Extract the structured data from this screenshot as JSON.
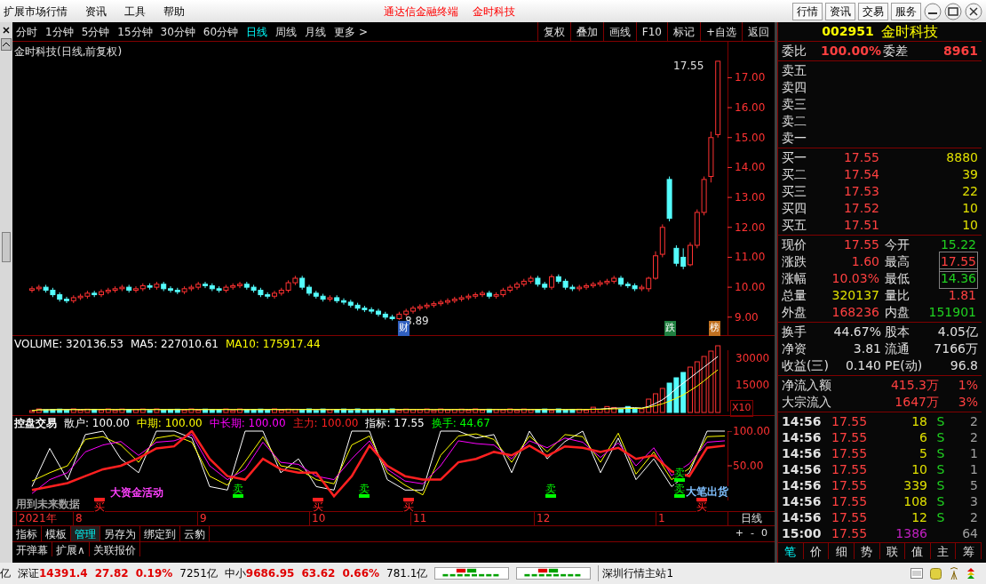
{
  "menu_bar": {
    "items": [
      "扩展市场行情",
      "资讯",
      "工具",
      "帮助"
    ],
    "title_parts": [
      "通达信金融终端",
      "金时科技"
    ],
    "buttons": [
      "行情",
      "资讯",
      "交易",
      "服务"
    ]
  },
  "period_tabs": [
    {
      "label": "分时",
      "selected": false
    },
    {
      "label": "1分钟",
      "selected": false
    },
    {
      "label": "5分钟",
      "selected": false
    },
    {
      "label": "15分钟",
      "selected": false
    },
    {
      "label": "30分钟",
      "selected": false
    },
    {
      "label": "60分钟",
      "selected": false
    },
    {
      "label": "日线",
      "selected": true
    },
    {
      "label": "周线",
      "selected": false
    },
    {
      "label": "月线",
      "selected": false
    },
    {
      "label": "更多 >",
      "selected": false
    }
  ],
  "toolbar_buttons": [
    "复权",
    "叠加",
    "画线",
    "F10",
    "标记",
    "+自选",
    "返回"
  ],
  "chart": {
    "title": "金时科技(日线,前复权)",
    "high_label": "17.55",
    "low_label": "8.89",
    "event_marks": [
      {
        "label": "财",
        "color": "#3060c0"
      },
      {
        "label": "跌",
        "color": "#208040"
      },
      {
        "label": "榜",
        "color": "#c07020"
      }
    ],
    "chart_data": {
      "type": "candlestick",
      "ylim": [
        8.4,
        18.2
      ],
      "yticks": [
        {
          "value": 17,
          "label": "17.00"
        },
        {
          "value": 16,
          "label": "16.00"
        },
        {
          "value": 15,
          "label": "15.00"
        },
        {
          "value": 14,
          "label": "14.00"
        },
        {
          "value": 13,
          "label": "13.00"
        },
        {
          "value": 12,
          "label": "12.00"
        },
        {
          "value": 11,
          "label": "11.00"
        },
        {
          "value": 10,
          "label": "10.00"
        },
        {
          "value": 9,
          "label": "9.00"
        }
      ],
      "ohlc": [
        [
          9.9,
          10.03,
          9.82,
          9.95
        ],
        [
          9.95,
          10.08,
          9.87,
          10.0
        ],
        [
          10.0,
          10.08,
          9.82,
          9.9
        ],
        [
          9.9,
          9.98,
          9.67,
          9.75
        ],
        [
          9.75,
          9.83,
          9.52,
          9.6
        ],
        [
          9.6,
          9.68,
          9.47,
          9.55
        ],
        [
          9.55,
          9.73,
          9.47,
          9.65
        ],
        [
          9.65,
          9.78,
          9.57,
          9.7
        ],
        [
          9.7,
          9.88,
          9.62,
          9.8
        ],
        [
          9.8,
          9.88,
          9.67,
          9.75
        ],
        [
          9.75,
          9.93,
          9.67,
          9.85
        ],
        [
          9.85,
          9.98,
          9.77,
          9.9
        ],
        [
          9.9,
          10.03,
          9.82,
          9.95
        ],
        [
          9.95,
          10.08,
          9.87,
          10.0
        ],
        [
          10.0,
          10.08,
          9.82,
          9.9
        ],
        [
          9.9,
          10.03,
          9.82,
          9.95
        ],
        [
          9.95,
          10.13,
          9.87,
          10.05
        ],
        [
          10.05,
          10.13,
          9.92,
          10.0
        ],
        [
          10.0,
          10.18,
          9.92,
          10.1
        ],
        [
          10.1,
          10.18,
          9.87,
          9.95
        ],
        [
          9.95,
          10.03,
          9.82,
          9.9
        ],
        [
          9.9,
          9.98,
          9.77,
          9.85
        ],
        [
          9.85,
          10.03,
          9.77,
          9.95
        ],
        [
          9.95,
          10.08,
          9.87,
          10.0
        ],
        [
          10.0,
          10.18,
          9.92,
          10.1
        ],
        [
          10.1,
          10.18,
          9.97,
          10.05
        ],
        [
          10.05,
          10.13,
          9.87,
          9.95
        ],
        [
          9.95,
          10.03,
          9.82,
          9.9
        ],
        [
          9.9,
          10.08,
          9.82,
          10.0
        ],
        [
          10.0,
          10.13,
          9.92,
          10.05
        ],
        [
          10.05,
          10.18,
          9.97,
          10.1
        ],
        [
          10.1,
          10.18,
          9.92,
          10.0
        ],
        [
          10.0,
          10.08,
          9.82,
          9.9
        ],
        [
          9.9,
          9.98,
          9.67,
          9.75
        ],
        [
          9.75,
          9.83,
          9.62,
          9.7
        ],
        [
          9.7,
          9.88,
          9.62,
          9.8
        ],
        [
          9.8,
          9.98,
          9.72,
          9.9
        ],
        [
          9.9,
          10.23,
          9.82,
          10.15
        ],
        [
          10.15,
          10.38,
          10.07,
          10.3
        ],
        [
          10.3,
          10.38,
          9.92,
          10.0
        ],
        [
          10.0,
          10.08,
          9.72,
          9.8
        ],
        [
          9.8,
          9.88,
          9.62,
          9.7
        ],
        [
          9.7,
          9.78,
          9.52,
          9.6
        ],
        [
          9.6,
          9.73,
          9.52,
          9.65
        ],
        [
          9.65,
          9.73,
          9.47,
          9.55
        ],
        [
          9.55,
          9.63,
          9.42,
          9.5
        ],
        [
          9.5,
          9.58,
          9.32,
          9.4
        ],
        [
          9.4,
          9.48,
          9.22,
          9.3
        ],
        [
          9.3,
          9.38,
          9.17,
          9.25
        ],
        [
          9.25,
          9.33,
          9.12,
          9.2
        ],
        [
          9.2,
          9.28,
          9.02,
          9.1
        ],
        [
          9.1,
          9.18,
          8.92,
          9.0
        ],
        [
          9.0,
          9.08,
          8.89,
          8.95
        ],
        [
          8.95,
          9.18,
          8.91,
          9.1
        ],
        [
          9.1,
          9.28,
          9.02,
          9.2
        ],
        [
          9.2,
          9.38,
          9.12,
          9.3
        ],
        [
          9.3,
          9.43,
          9.22,
          9.35
        ],
        [
          9.35,
          9.48,
          9.27,
          9.4
        ],
        [
          9.4,
          9.53,
          9.32,
          9.45
        ],
        [
          9.45,
          9.58,
          9.37,
          9.5
        ],
        [
          9.5,
          9.63,
          9.42,
          9.55
        ],
        [
          9.55,
          9.68,
          9.47,
          9.6
        ],
        [
          9.6,
          9.73,
          9.52,
          9.65
        ],
        [
          9.65,
          9.78,
          9.57,
          9.7
        ],
        [
          9.7,
          9.83,
          9.62,
          9.75
        ],
        [
          9.75,
          9.88,
          9.67,
          9.8
        ],
        [
          9.8,
          9.88,
          9.62,
          9.7
        ],
        [
          9.7,
          9.83,
          9.62,
          9.75
        ],
        [
          9.75,
          9.98,
          9.67,
          9.9
        ],
        [
          9.9,
          10.08,
          9.82,
          10.0
        ],
        [
          10.0,
          10.18,
          9.92,
          10.1
        ],
        [
          10.1,
          10.28,
          10.02,
          10.2
        ],
        [
          10.2,
          10.38,
          10.12,
          10.3
        ],
        [
          10.3,
          10.38,
          10.02,
          10.1
        ],
        [
          10.1,
          10.18,
          9.92,
          10.0
        ],
        [
          10.0,
          10.43,
          9.92,
          10.35
        ],
        [
          10.35,
          10.43,
          10.12,
          10.2
        ],
        [
          10.2,
          10.28,
          9.92,
          10.0
        ],
        [
          10.0,
          10.08,
          9.87,
          9.95
        ],
        [
          9.95,
          10.08,
          9.87,
          10.0
        ],
        [
          10.0,
          10.13,
          9.92,
          10.05
        ],
        [
          10.05,
          10.18,
          9.97,
          10.1
        ],
        [
          10.1,
          10.23,
          10.02,
          10.15
        ],
        [
          10.15,
          10.28,
          10.07,
          10.2
        ],
        [
          10.2,
          10.38,
          10.12,
          10.3
        ],
        [
          10.3,
          10.38,
          10.02,
          10.1
        ],
        [
          10.1,
          10.18,
          9.97,
          10.05
        ],
        [
          10.05,
          10.13,
          9.87,
          9.95
        ],
        [
          9.95,
          10.08,
          9.87,
          10.0
        ],
        [
          9.95,
          10.35,
          9.85,
          10.3
        ],
        [
          10.3,
          11.2,
          10.25,
          11.05
        ],
        [
          11.1,
          12.1,
          11.0,
          12.0
        ],
        [
          13.6,
          13.7,
          12.2,
          12.3
        ],
        [
          11.3,
          11.4,
          10.7,
          10.8
        ],
        [
          11.0,
          11.3,
          10.6,
          10.7
        ],
        [
          10.75,
          11.5,
          10.7,
          11.4
        ],
        [
          11.4,
          12.6,
          11.3,
          12.5
        ],
        [
          12.5,
          13.7,
          12.4,
          13.6
        ],
        [
          13.7,
          15.2,
          13.5,
          15.0
        ],
        [
          15.1,
          17.55,
          15.0,
          17.55
        ]
      ]
    }
  },
  "volume": {
    "legend": [
      {
        "text": "VOLUME: 320136.53",
        "color": "#ffffff"
      },
      {
        "text": "MA5: 227010.61",
        "color": "#ffffff"
      },
      {
        "text": "MA10: 175917.44",
        "color": "#ffff00"
      }
    ],
    "axis": [
      "30000",
      "15000"
    ],
    "unit": "X10"
  },
  "indicator": {
    "legend": [
      {
        "text": "控盘交易",
        "color": "#ffffff"
      },
      {
        "text": "散户: 100.00",
        "color": "#ffffff"
      },
      {
        "text": "中期: 100.00",
        "color": "#ffff00"
      },
      {
        "text": "中长期: 100.00",
        "color": "#ff00ff"
      },
      {
        "text": "主力: 100.00",
        "color": "#ff2020"
      },
      {
        "text": "指标: 17.55",
        "color": "#ffffff"
      },
      {
        "text": "换手: 44.67",
        "color": "#00ff00"
      }
    ],
    "chart_data": {
      "type": "line",
      "ylim": [
        0,
        100
      ],
      "yticks": [
        {
          "value": 100,
          "label": "100.00"
        },
        {
          "value": 50,
          "label": "50.00"
        }
      ],
      "series": [
        {
          "color": "#ffffff",
          "values": [
            20,
            75,
            30,
            95,
            100,
            60,
            40,
            100,
            100,
            90,
            20,
            15,
            100,
            100,
            40,
            60,
            20,
            15,
            100,
            100,
            30,
            15,
            15,
            100,
            100,
            90,
            95,
            40,
            100,
            60,
            85,
            100,
            40,
            90,
            30,
            60,
            20,
            40,
            100,
            100
          ]
        },
        {
          "color": "#ffff00",
          "values": [
            28,
            40,
            50,
            88,
            92,
            80,
            55,
            90,
            94,
            84,
            35,
            22,
            56,
            92,
            50,
            45,
            30,
            24,
            80,
            93,
            40,
            22,
            8,
            65,
            93,
            96,
            88,
            55,
            93,
            70,
            95,
            92,
            55,
            97,
            38,
            70,
            30,
            46,
            92,
            93
          ]
        },
        {
          "color": "#ff00ff",
          "values": [
            10,
            30,
            40,
            70,
            80,
            85,
            65,
            84,
            86,
            95,
            50,
            30,
            45,
            84,
            55,
            52,
            35,
            30,
            60,
            86,
            45,
            28,
            24,
            50,
            86,
            82,
            80,
            60,
            86,
            76,
            90,
            84,
            62,
            83,
            50,
            76,
            36,
            53,
            84,
            86
          ]
        },
        {
          "color": "#ff2020",
          "values": [
            15,
            20,
            25,
            35,
            45,
            50,
            61,
            75,
            78,
            100,
            60,
            35,
            30,
            60,
            45,
            40,
            40,
            6,
            35,
            79,
            50,
            35,
            30,
            30,
            55,
            60,
            70,
            65,
            79,
            64,
            78,
            76,
            70,
            76,
            60,
            65,
            42,
            35,
            76,
            79
          ]
        }
      ]
    },
    "labels": [
      {
        "text": "大资金活动",
        "kind": "note",
        "color": "#ff40ff"
      },
      {
        "text": "用到未来数据",
        "kind": "note",
        "color": "#a0a0a0"
      },
      {
        "text": "卖",
        "kind": "sell",
        "color": "#00ff00"
      },
      {
        "text": "卖",
        "kind": "sell",
        "color": "#00ff00"
      },
      {
        "text": "卖",
        "kind": "sell",
        "color": "#00ff00"
      },
      {
        "text": "卖",
        "kind": "sell",
        "color": "#00ff00"
      },
      {
        "text": "卖",
        "kind": "sell",
        "color": "#00ff00"
      },
      {
        "text": "买",
        "kind": "buy",
        "color": "#ff2020"
      },
      {
        "text": "买",
        "kind": "buy",
        "color": "#ff2020"
      },
      {
        "text": "买",
        "kind": "buy",
        "color": "#ff2020"
      },
      {
        "text": "买",
        "kind": "buy",
        "color": "#ff2020"
      },
      {
        "text": "大笔出货",
        "kind": "note",
        "color": "#80c0ff"
      }
    ]
  },
  "date_axis": [
    "2021年",
    "8",
    "9",
    "10",
    "11",
    "12",
    "1"
  ],
  "period_label": "日线",
  "bottom_tabs": [
    {
      "label": "指标",
      "selected": false
    },
    {
      "label": "模板",
      "selected": false
    },
    {
      "label": "管理",
      "selected": true
    },
    {
      "label": "另存为",
      "selected": false
    },
    {
      "label": "绑定到",
      "selected": false
    },
    {
      "label": "云豹",
      "selected": false
    }
  ],
  "zoom_buttons": [
    "+",
    "-",
    "0"
  ],
  "bottom_tabs_2": [
    "开弹幕",
    "扩展∧",
    "关联报价"
  ],
  "status_bar": {
    "lead": "亿",
    "indices": [
      {
        "name": "深证",
        "value": "14391.4",
        "change": "27.82",
        "percent": "0.19%",
        "amount": "7251亿"
      },
      {
        "name": "中小",
        "value": "9686.95",
        "change": "63.62",
        "percent": "0.66%",
        "amount": "781.1亿"
      }
    ],
    "server": "深圳行情主站1"
  },
  "quote": {
    "code": "002951",
    "name": "金时科技",
    "ratio_label": "委比",
    "ratio": "100.00%",
    "diff_label": "委差",
    "diff": "8961",
    "sells": [
      {
        "label": "卖五"
      },
      {
        "label": "卖四"
      },
      {
        "label": "卖三"
      },
      {
        "label": "卖二"
      },
      {
        "label": "卖一"
      }
    ],
    "buys": [
      {
        "label": "买一",
        "price": "17.55",
        "volume": "8880"
      },
      {
        "label": "买二",
        "price": "17.54",
        "volume": "39"
      },
      {
        "label": "买三",
        "price": "17.53",
        "volume": "22"
      },
      {
        "label": "买四",
        "price": "17.52",
        "volume": "10"
      },
      {
        "label": "买五",
        "price": "17.51",
        "volume": "10"
      }
    ],
    "stats": [
      {
        "label": "现价",
        "value": "17.55",
        "color": "#ff4040",
        "boxed": false
      },
      {
        "label": "今开",
        "value": "15.22",
        "color": "#20d020",
        "boxed": false
      },
      {
        "label": "涨跌",
        "value": "1.60",
        "color": "#ff4040",
        "boxed": false
      },
      {
        "label": "最高",
        "value": "17.55",
        "color": "#ff4040",
        "boxed": true
      },
      {
        "label": "涨幅",
        "value": "10.03%",
        "color": "#ff4040",
        "boxed": false
      },
      {
        "label": "最低",
        "value": "14.36",
        "color": "#20d020",
        "boxed": true
      },
      {
        "label": "总量",
        "value": "320137",
        "color": "#e0e000",
        "boxed": false
      },
      {
        "label": "量比",
        "value": "1.81",
        "color": "#ff4040",
        "boxed": false
      },
      {
        "label": "外盘",
        "value": "168236",
        "color": "#ff4040",
        "boxed": false
      },
      {
        "label": "内盘",
        "value": "151901",
        "color": "#20d020",
        "boxed": false
      }
    ],
    "fundamentals": [
      {
        "label": "换手",
        "value": "44.67%",
        "label2": "股本",
        "value2": "4.05亿"
      },
      {
        "label": "净资",
        "value": "3.81",
        "label2": "流通",
        "value2": "7166万"
      },
      {
        "label": "收益(三)",
        "value": "0.140",
        "label2": "PE(动)",
        "value2": "96.8"
      }
    ],
    "flows": [
      {
        "label": "净流入额",
        "value": "415.3万",
        "percent": "1%"
      },
      {
        "label": "大宗流入",
        "value": "1647万",
        "percent": "3%"
      }
    ],
    "ticks": [
      {
        "time": "14:56",
        "price": "17.55",
        "volume": "18",
        "side": "S",
        "count": "2",
        "big": false
      },
      {
        "time": "14:56",
        "price": "17.55",
        "volume": "6",
        "side": "S",
        "count": "2",
        "big": false
      },
      {
        "time": "14:56",
        "price": "17.55",
        "volume": "5",
        "side": "S",
        "count": "1",
        "big": false
      },
      {
        "time": "14:56",
        "price": "17.55",
        "volume": "10",
        "side": "S",
        "count": "1",
        "big": false
      },
      {
        "time": "14:56",
        "price": "17.55",
        "volume": "339",
        "side": "S",
        "count": "5",
        "big": false
      },
      {
        "time": "14:56",
        "price": "17.55",
        "volume": "108",
        "side": "S",
        "count": "3",
        "big": false
      },
      {
        "time": "14:56",
        "price": "17.55",
        "volume": "12",
        "side": "S",
        "count": "2",
        "big": false
      },
      {
        "time": "15:00",
        "price": "17.55",
        "volume": "1386",
        "count": "64",
        "big": true
      }
    ],
    "tabs": [
      {
        "label": "笔",
        "selected": true
      },
      {
        "label": "价",
        "selected": false
      },
      {
        "label": "细",
        "selected": false
      },
      {
        "label": "势",
        "selected": false
      },
      {
        "label": "联",
        "selected": false
      },
      {
        "label": "值",
        "selected": false
      },
      {
        "label": "主",
        "selected": false
      },
      {
        "label": "筹",
        "selected": false
      }
    ]
  }
}
